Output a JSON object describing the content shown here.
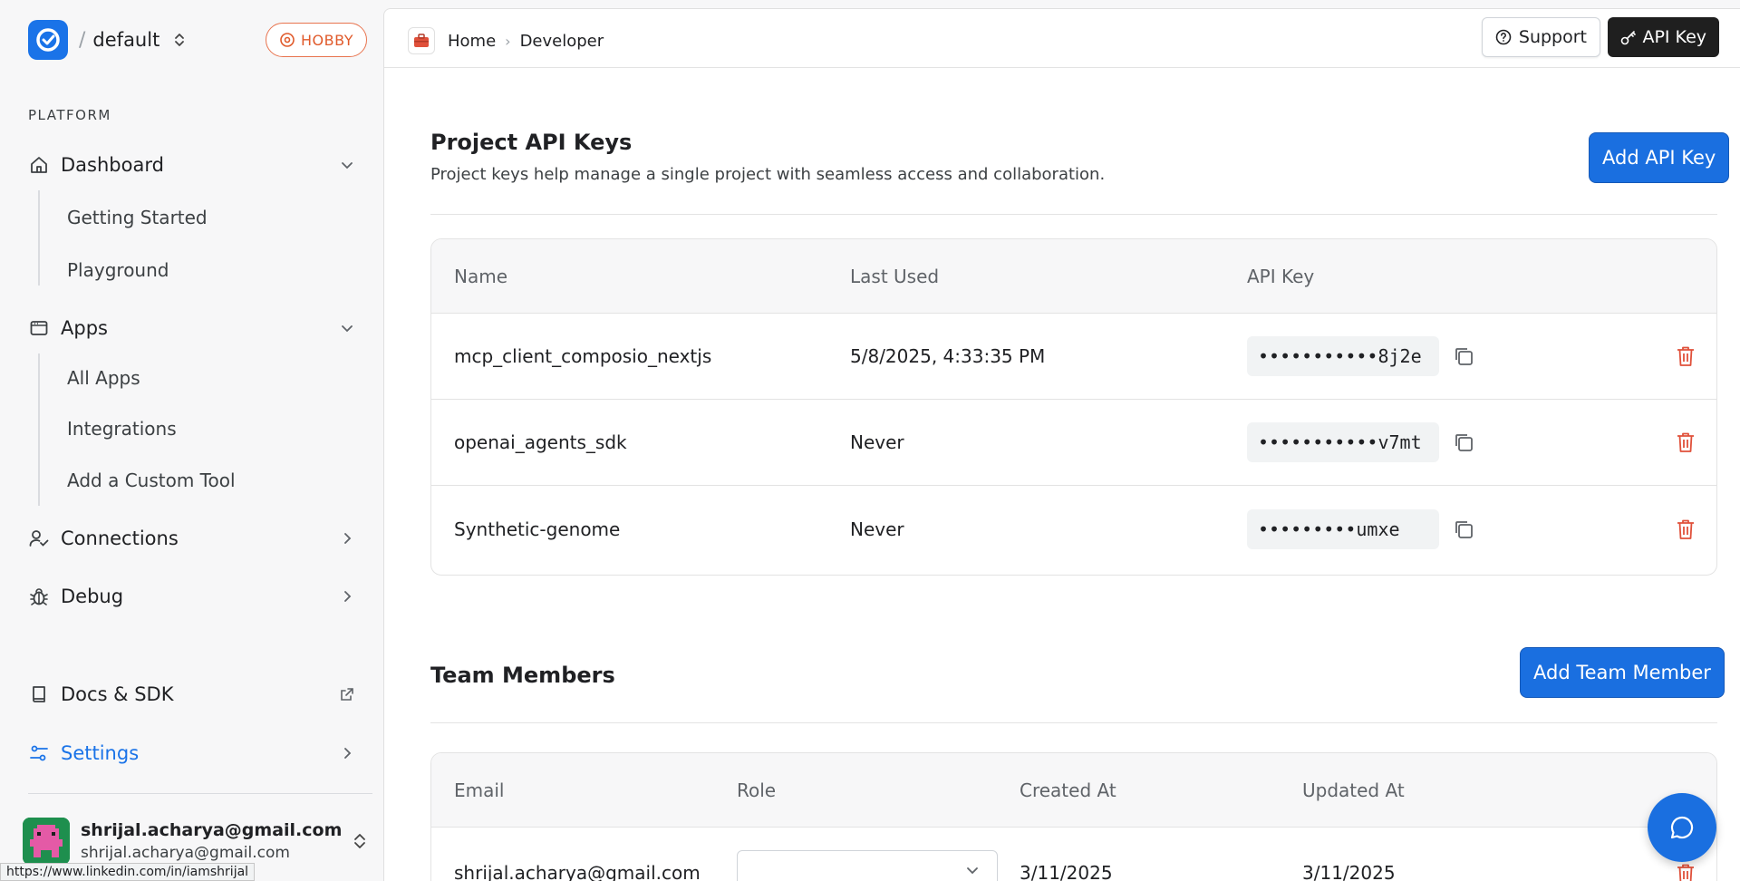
{
  "workspace": {
    "slash": "/",
    "name": "default",
    "plan_badge": "HOBBY"
  },
  "sidebar": {
    "section_label": "PLATFORM",
    "dashboard": {
      "label": "Dashboard",
      "children": [
        "Getting Started",
        "Playground"
      ]
    },
    "apps": {
      "label": "Apps",
      "children": [
        "All Apps",
        "Integrations",
        "Add a Custom Tool"
      ]
    },
    "connections": {
      "label": "Connections"
    },
    "debug": {
      "label": "Debug"
    },
    "docs": {
      "label": "Docs & SDK"
    },
    "settings": {
      "label": "Settings"
    },
    "user": {
      "name": "shrijal.acharya@gmail.com",
      "email": "shrijal.acharya@gmail.com"
    }
  },
  "status_url": "https://www.linkedin.com/in/iamshrijal",
  "topbar": {
    "breadcrumb": [
      "Home",
      "Developer"
    ],
    "separator": "›",
    "support_label": "Support",
    "apikey_label": "API Key"
  },
  "api_keys": {
    "title": "Project API Keys",
    "subtitle": "Project keys help manage a single project with seamless access and collaboration.",
    "add_label": "Add API Key",
    "columns": [
      "Name",
      "Last Used",
      "API Key"
    ],
    "rows": [
      {
        "name": "mcp_client_composio_nextjs",
        "last_used": "5/8/2025, 4:33:35 PM",
        "key": "•••••••••••8j2e"
      },
      {
        "name": "openai_agents_sdk",
        "last_used": "Never",
        "key": "•••••••••••v7mt"
      },
      {
        "name": "Synthetic-genome",
        "last_used": "Never",
        "key": "•••••••••umxe"
      }
    ]
  },
  "team": {
    "title": "Team Members",
    "add_label": "Add Team Member",
    "columns": [
      "Email",
      "Role",
      "Created At",
      "Updated At"
    ],
    "rows": [
      {
        "email": "shrijal.acharya@gmail.com",
        "role": "",
        "created_at": "3/11/2025",
        "updated_at": "3/11/2025"
      }
    ]
  },
  "colors": {
    "accent": "#1a6fe0",
    "danger": "#e0503a",
    "hobby": "#e05a2b"
  }
}
